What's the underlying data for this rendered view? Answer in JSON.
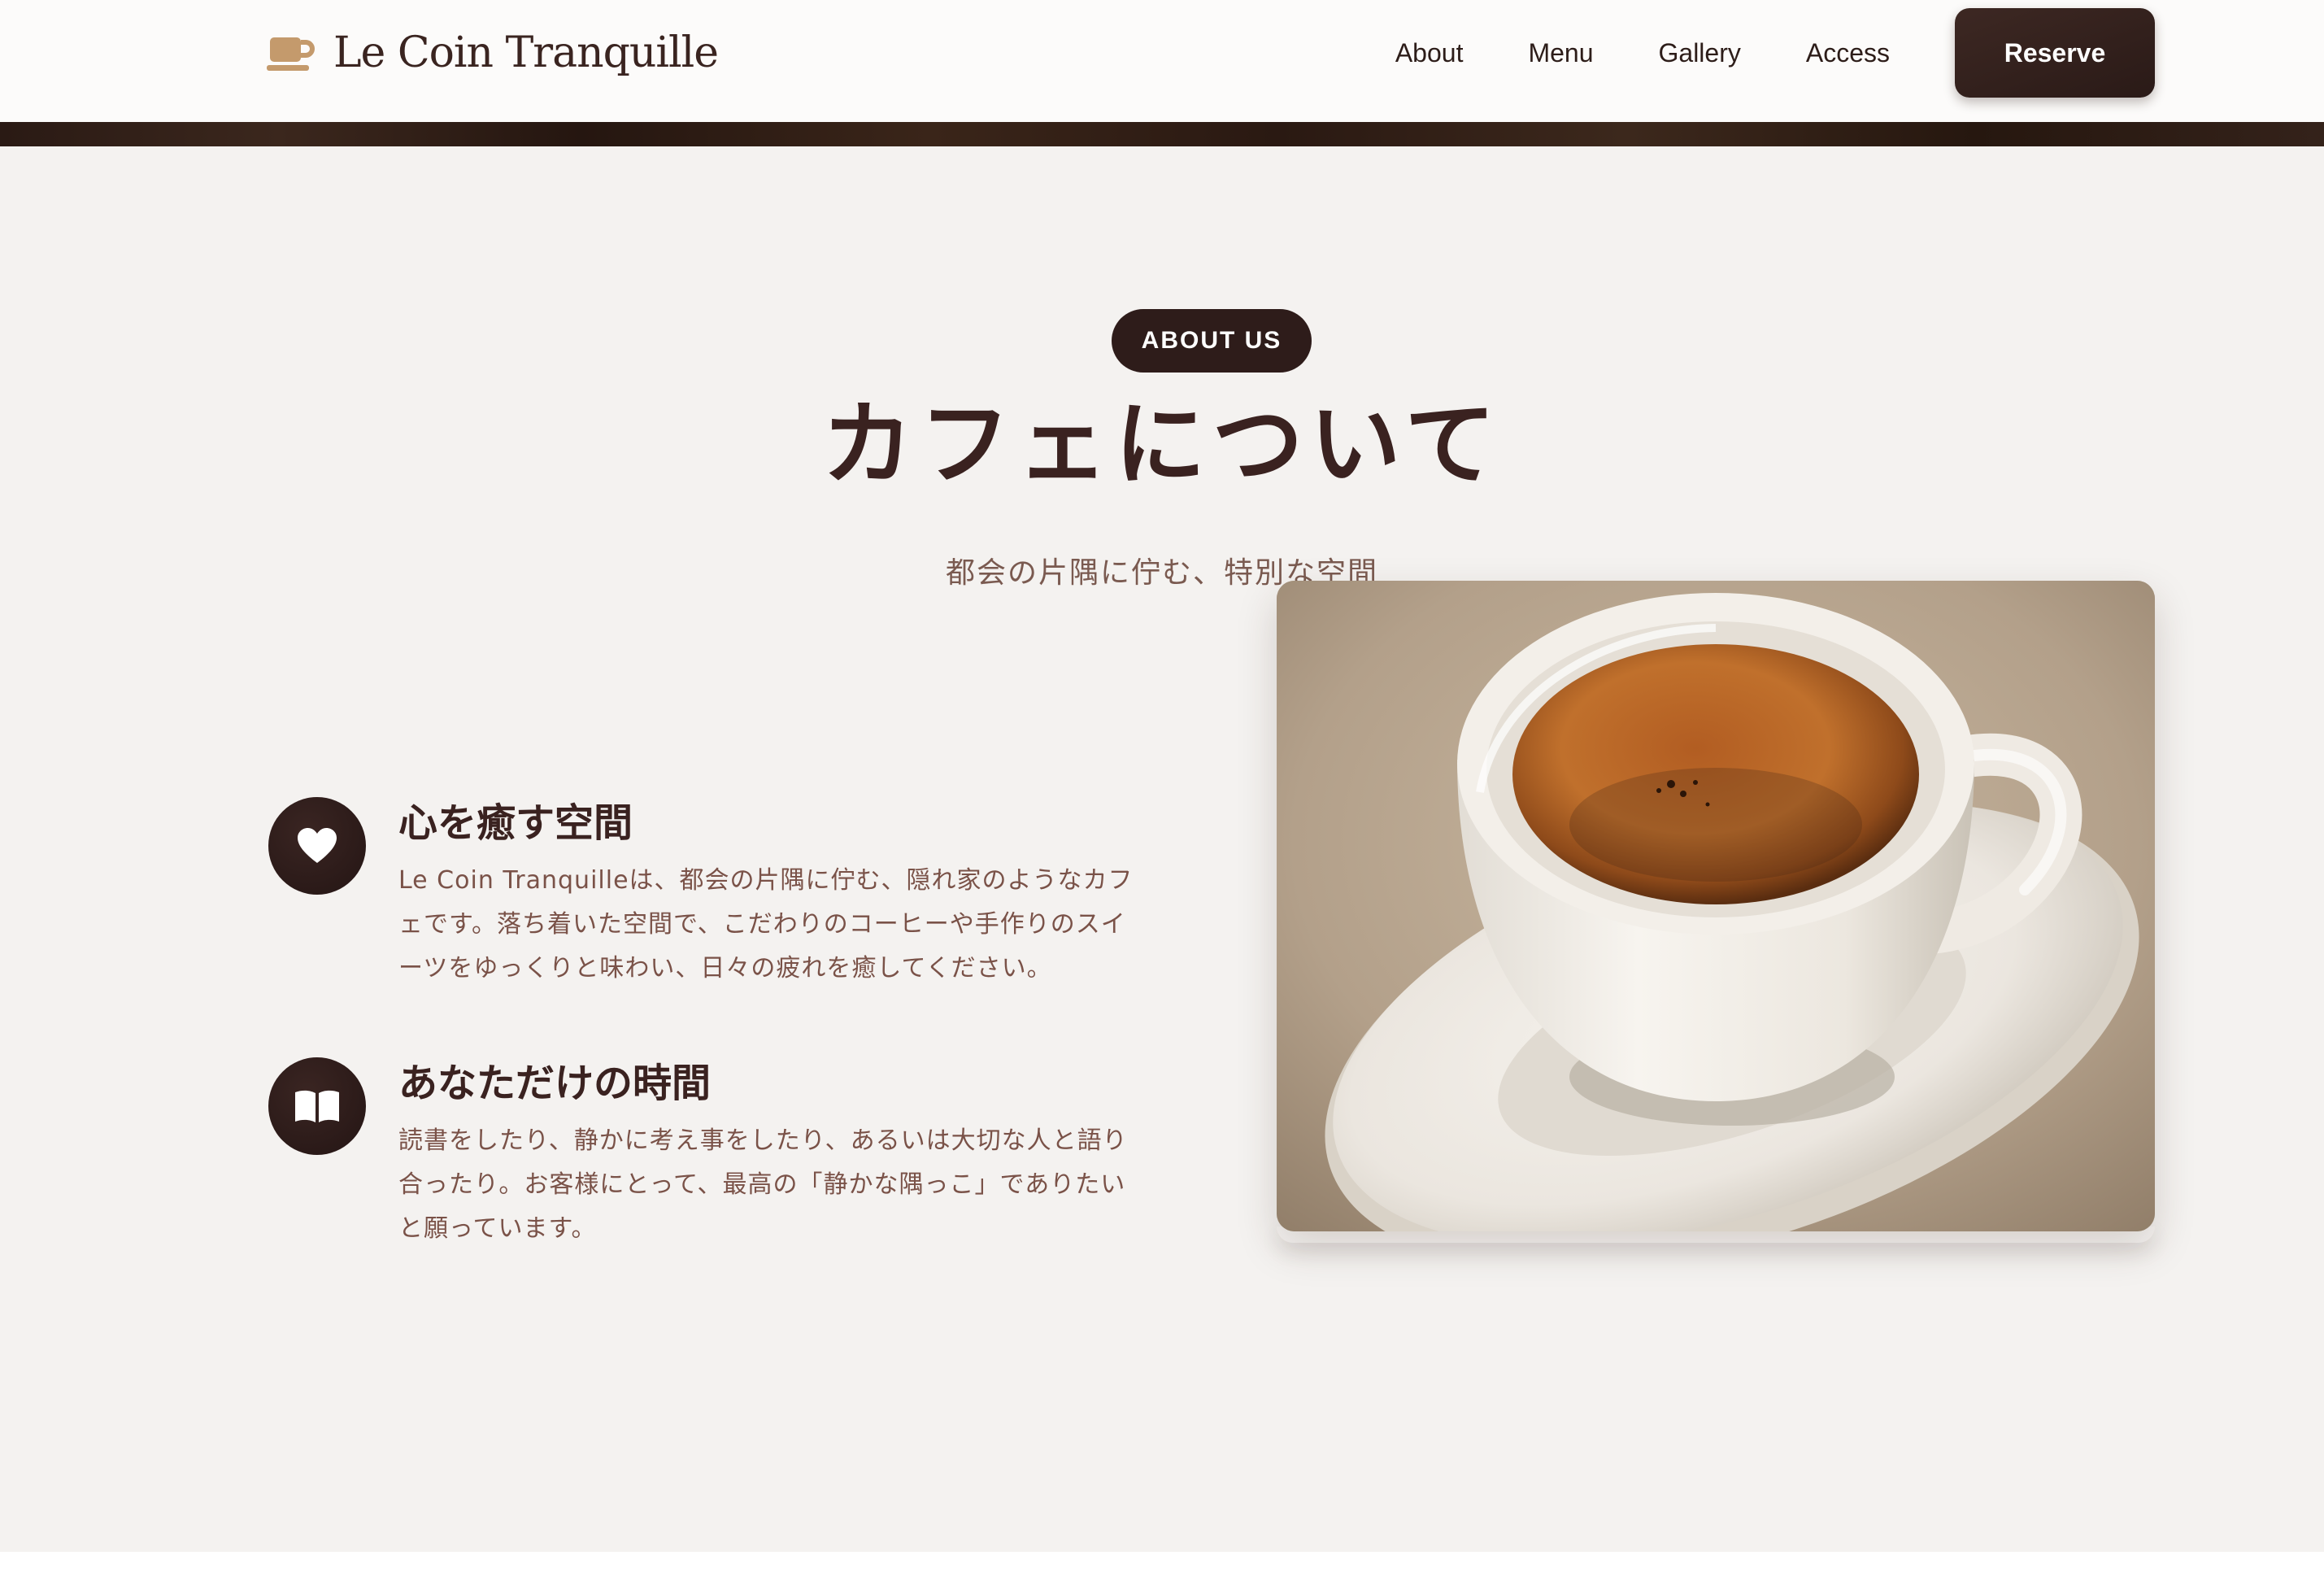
{
  "header": {
    "logo_text": "Le Coin Tranquille",
    "logo_icon": "coffee-cup-icon",
    "nav": [
      {
        "label": "About"
      },
      {
        "label": "Menu"
      },
      {
        "label": "Gallery"
      },
      {
        "label": "Access"
      }
    ],
    "reserve_label": "Reserve"
  },
  "about": {
    "badge": "ABOUT US",
    "title": "カフェについて",
    "subtitle": "都会の片隅に佇む、特別な空間",
    "features": [
      {
        "icon": "heart-icon",
        "title": "心を癒す空間",
        "text": "Le Coin Tranquilleは、都会の片隅に佇む、隠れ家のようなカフェです。落ち着いた空間で、こだわりのコーヒーや手作りのスイーツをゆっくりと味わい、日々の疲れを癒してください。"
      },
      {
        "icon": "open-book-icon",
        "title": "あなただけの時間",
        "text": "読書をしたり、静かに考え事をしたり、あるいは大切な人と語り合ったり。お客様にとって、最高の「静かな隅っこ」でありたいと願っています。"
      }
    ],
    "image": "espresso-cup-photo"
  },
  "colors": {
    "brand_dark": "#2e1c1a",
    "accent": "#c49a6c",
    "section_bg": "#f4f2f0",
    "text_muted": "#7a5248"
  }
}
